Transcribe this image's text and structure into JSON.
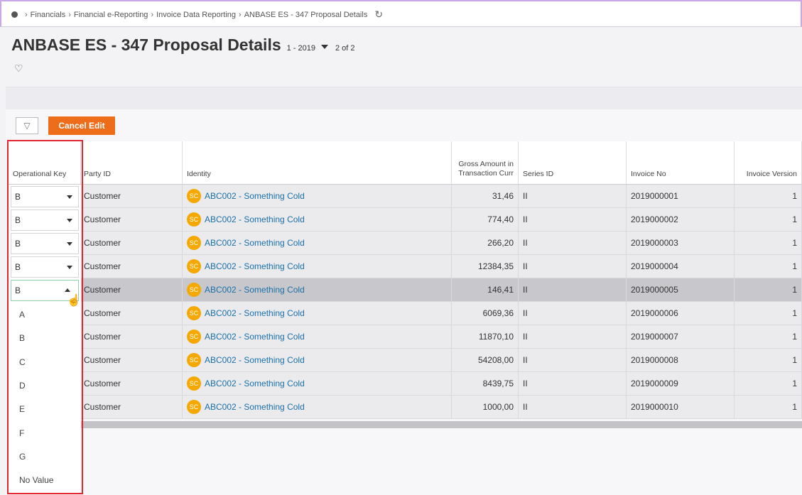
{
  "breadcrumb": [
    "Financials",
    "Financial e-Reporting",
    "Invoice Data Reporting",
    "ANBASE ES - 347 Proposal Details"
  ],
  "page": {
    "title": "ANBASE ES - 347 Proposal Details",
    "period": "1 - 2019",
    "pager": "2 of 2"
  },
  "toolbar": {
    "cancel_label": "Cancel Edit"
  },
  "columns": {
    "opkey": "Operational Key",
    "party": "Party ID",
    "identity": "Identity",
    "gross": "Gross Amount in Transaction Curr",
    "series": "Series ID",
    "invoice_no": "Invoice No",
    "invoice_version": "Invoice Version"
  },
  "rows": [
    {
      "opkey": "B",
      "party": "Customer",
      "badge": "SC",
      "identity": "ABC002 - Something Cold",
      "gross": "31,46",
      "series": "II",
      "invoice_no": "2019000001",
      "version": "1"
    },
    {
      "opkey": "B",
      "party": "Customer",
      "badge": "SC",
      "identity": "ABC002 - Something Cold",
      "gross": "774,40",
      "series": "II",
      "invoice_no": "2019000002",
      "version": "1"
    },
    {
      "opkey": "B",
      "party": "Customer",
      "badge": "SC",
      "identity": "ABC002 - Something Cold",
      "gross": "266,20",
      "series": "II",
      "invoice_no": "2019000003",
      "version": "1"
    },
    {
      "opkey": "B",
      "party": "Customer",
      "badge": "SC",
      "identity": "ABC002 - Something Cold",
      "gross": "12384,35",
      "series": "II",
      "invoice_no": "2019000004",
      "version": "1"
    },
    {
      "opkey": "B",
      "party": "Customer",
      "badge": "SC",
      "identity": "ABC002 - Something Cold",
      "gross": "146,41",
      "series": "II",
      "invoice_no": "2019000005",
      "version": "1"
    },
    {
      "opkey": "",
      "party": "Customer",
      "badge": "SC",
      "identity": "ABC002 - Something Cold",
      "gross": "6069,36",
      "series": "II",
      "invoice_no": "2019000006",
      "version": "1"
    },
    {
      "opkey": "",
      "party": "Customer",
      "badge": "SC",
      "identity": "ABC002 - Something Cold",
      "gross": "11870,10",
      "series": "II",
      "invoice_no": "2019000007",
      "version": "1"
    },
    {
      "opkey": "",
      "party": "Customer",
      "badge": "SC",
      "identity": "ABC002 - Something Cold",
      "gross": "54208,00",
      "series": "II",
      "invoice_no": "2019000008",
      "version": "1"
    },
    {
      "opkey": "",
      "party": "Customer",
      "badge": "SC",
      "identity": "ABC002 - Something Cold",
      "gross": "8439,75",
      "series": "II",
      "invoice_no": "2019000009",
      "version": "1"
    },
    {
      "opkey": "",
      "party": "Customer",
      "badge": "SC",
      "identity": "ABC002 - Something Cold",
      "gross": "1000,00",
      "series": "II",
      "invoice_no": "2019000010",
      "version": "1"
    }
  ],
  "dropdown": {
    "options": [
      "A",
      "B",
      "C",
      "D",
      "E",
      "F",
      "G",
      "No Value"
    ]
  },
  "colors": {
    "accent": "#ed6d1b",
    "badge": "#f5a800",
    "link": "#1a6fa8",
    "highlight": "#e5262e"
  }
}
